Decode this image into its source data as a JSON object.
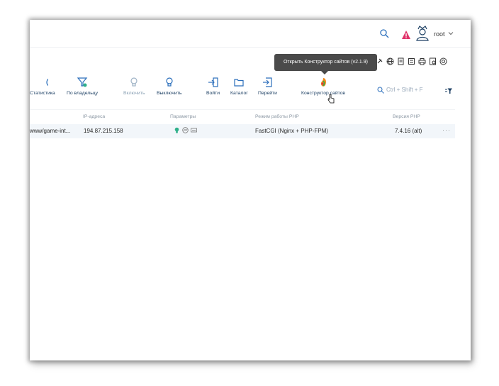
{
  "header": {
    "user_name": "root",
    "icons": [
      "search-icon",
      "alert-icon",
      "user-avatar-icon",
      "chevron-down-icon"
    ]
  },
  "tooltip": {
    "text": "Открыть Конструктор сайтов (v2.1.9)"
  },
  "toolbar": {
    "items": [
      {
        "label": "Статистика",
        "icon": "pie-chart-icon",
        "enabled": true
      },
      {
        "label": "По владельцу",
        "icon": "filter-icon",
        "enabled": true
      },
      {
        "label": "Включить",
        "icon": "bulb-on-icon",
        "enabled": false
      },
      {
        "label": "Выключить",
        "icon": "bulb-off-icon",
        "enabled": true
      },
      {
        "label": "Войти",
        "icon": "login-icon",
        "enabled": true
      },
      {
        "label": "Каталог",
        "icon": "folder-icon",
        "enabled": true
      },
      {
        "label": "Перейти",
        "icon": "goto-icon",
        "enabled": true
      },
      {
        "label": "Конструктор сайтов",
        "icon": "site-builder-icon",
        "enabled": true
      }
    ],
    "search_placeholder": "Ctrl + Shift + F"
  },
  "table": {
    "columns": [
      "IP-адреса",
      "Параметры",
      "Режим работы PHP",
      "Версия PHP"
    ],
    "rows": [
      {
        "domain": "www/game-int...",
        "ip": "194.87.215.158",
        "php_mode": "FastCGI (Nginx + PHP-FPM)",
        "php_version": "7.4.16 (alt)",
        "menu": "···"
      }
    ]
  },
  "colors": {
    "accent": "#1c3f63",
    "link_blue": "#2a6ebb",
    "alert": "#e0336a",
    "row_bg": "#f2f6fa",
    "tooltip_bg": "#4a4a4a"
  }
}
